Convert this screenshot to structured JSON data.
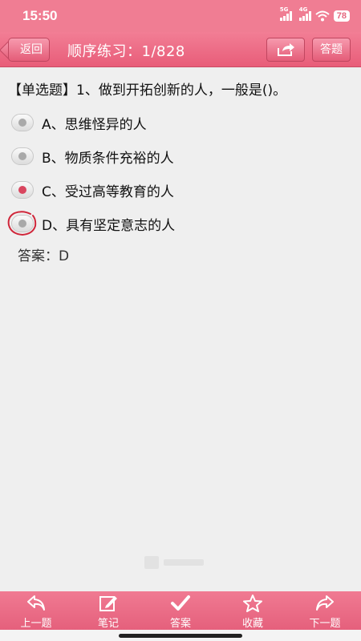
{
  "status_bar": {
    "time": "15:50",
    "network_1": "5G",
    "network_2": "4G",
    "battery": "78"
  },
  "header": {
    "back_label": "返回",
    "title": "顺序练习：1/828",
    "answer_sheet_label": "答题",
    "share_icon": "share-icon",
    "bg_color": "#e85d79"
  },
  "question": {
    "text": "【单选题】1、做到开拓创新的人，一般是()。",
    "options": [
      {
        "label": "A、思维怪异的人",
        "selected": false
      },
      {
        "label": "B、物质条件充裕的人",
        "selected": false
      },
      {
        "label": "C、受过高等教育的人",
        "selected": true
      },
      {
        "label": "D、具有坚定意志的人",
        "selected": false
      }
    ],
    "answer_text": "答案：D"
  },
  "bottom_nav": {
    "items": [
      {
        "label": "上一题",
        "icon": "arrow-left-icon"
      },
      {
        "label": "笔记",
        "icon": "edit-icon"
      },
      {
        "label": "答案",
        "icon": "checkmark-icon"
      },
      {
        "label": "收藏",
        "icon": "star-icon"
      },
      {
        "label": "下一题",
        "icon": "arrow-right-icon"
      }
    ]
  },
  "colors": {
    "accent": "#e85d79",
    "selected_dot": "#d9465f",
    "correct_circle": "#d0263a"
  }
}
